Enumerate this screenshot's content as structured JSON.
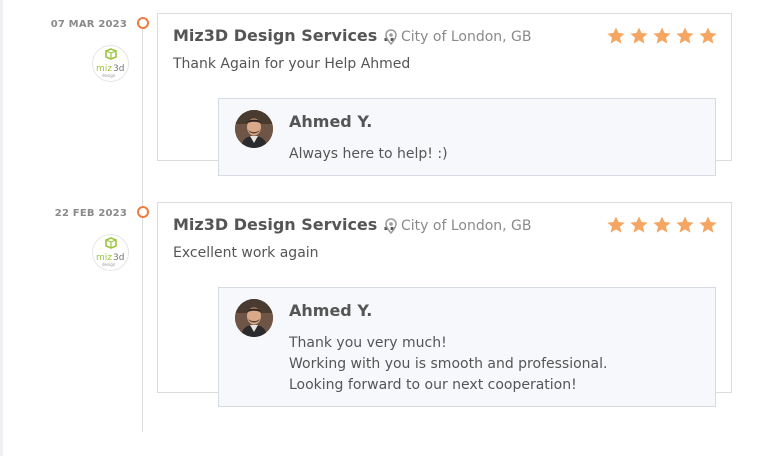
{
  "reviews": [
    {
      "date": "07 MAR 2023",
      "company": "Miz3D Design Services ..",
      "location": "City of London, GB",
      "rating": 5,
      "text": "Thank Again for your Help Ahmed",
      "logo": {
        "text": "miz",
        "text2": "3d",
        "sub": "design"
      },
      "reply": {
        "name": "Ahmed Y.",
        "lines": [
          "Always here to help! :)"
        ]
      }
    },
    {
      "date": "22 FEB 2023",
      "company": "Miz3D Design Services ..",
      "location": "City of London, GB",
      "rating": 5,
      "text": "Excellent work again",
      "logo": {
        "text": "miz",
        "text2": "3d",
        "sub": "design"
      },
      "reply": {
        "name": "Ahmed Y.",
        "lines": [
          "Thank you very much!",
          "Working with you is smooth and professional.",
          "Looking forward to our next cooperation!"
        ]
      }
    }
  ],
  "colors": {
    "accent": "#f07b3f",
    "star": "#f5a662",
    "logo_green": "#9bc53d"
  },
  "icons": {
    "location": "map-pin-icon",
    "star": "star-icon"
  }
}
